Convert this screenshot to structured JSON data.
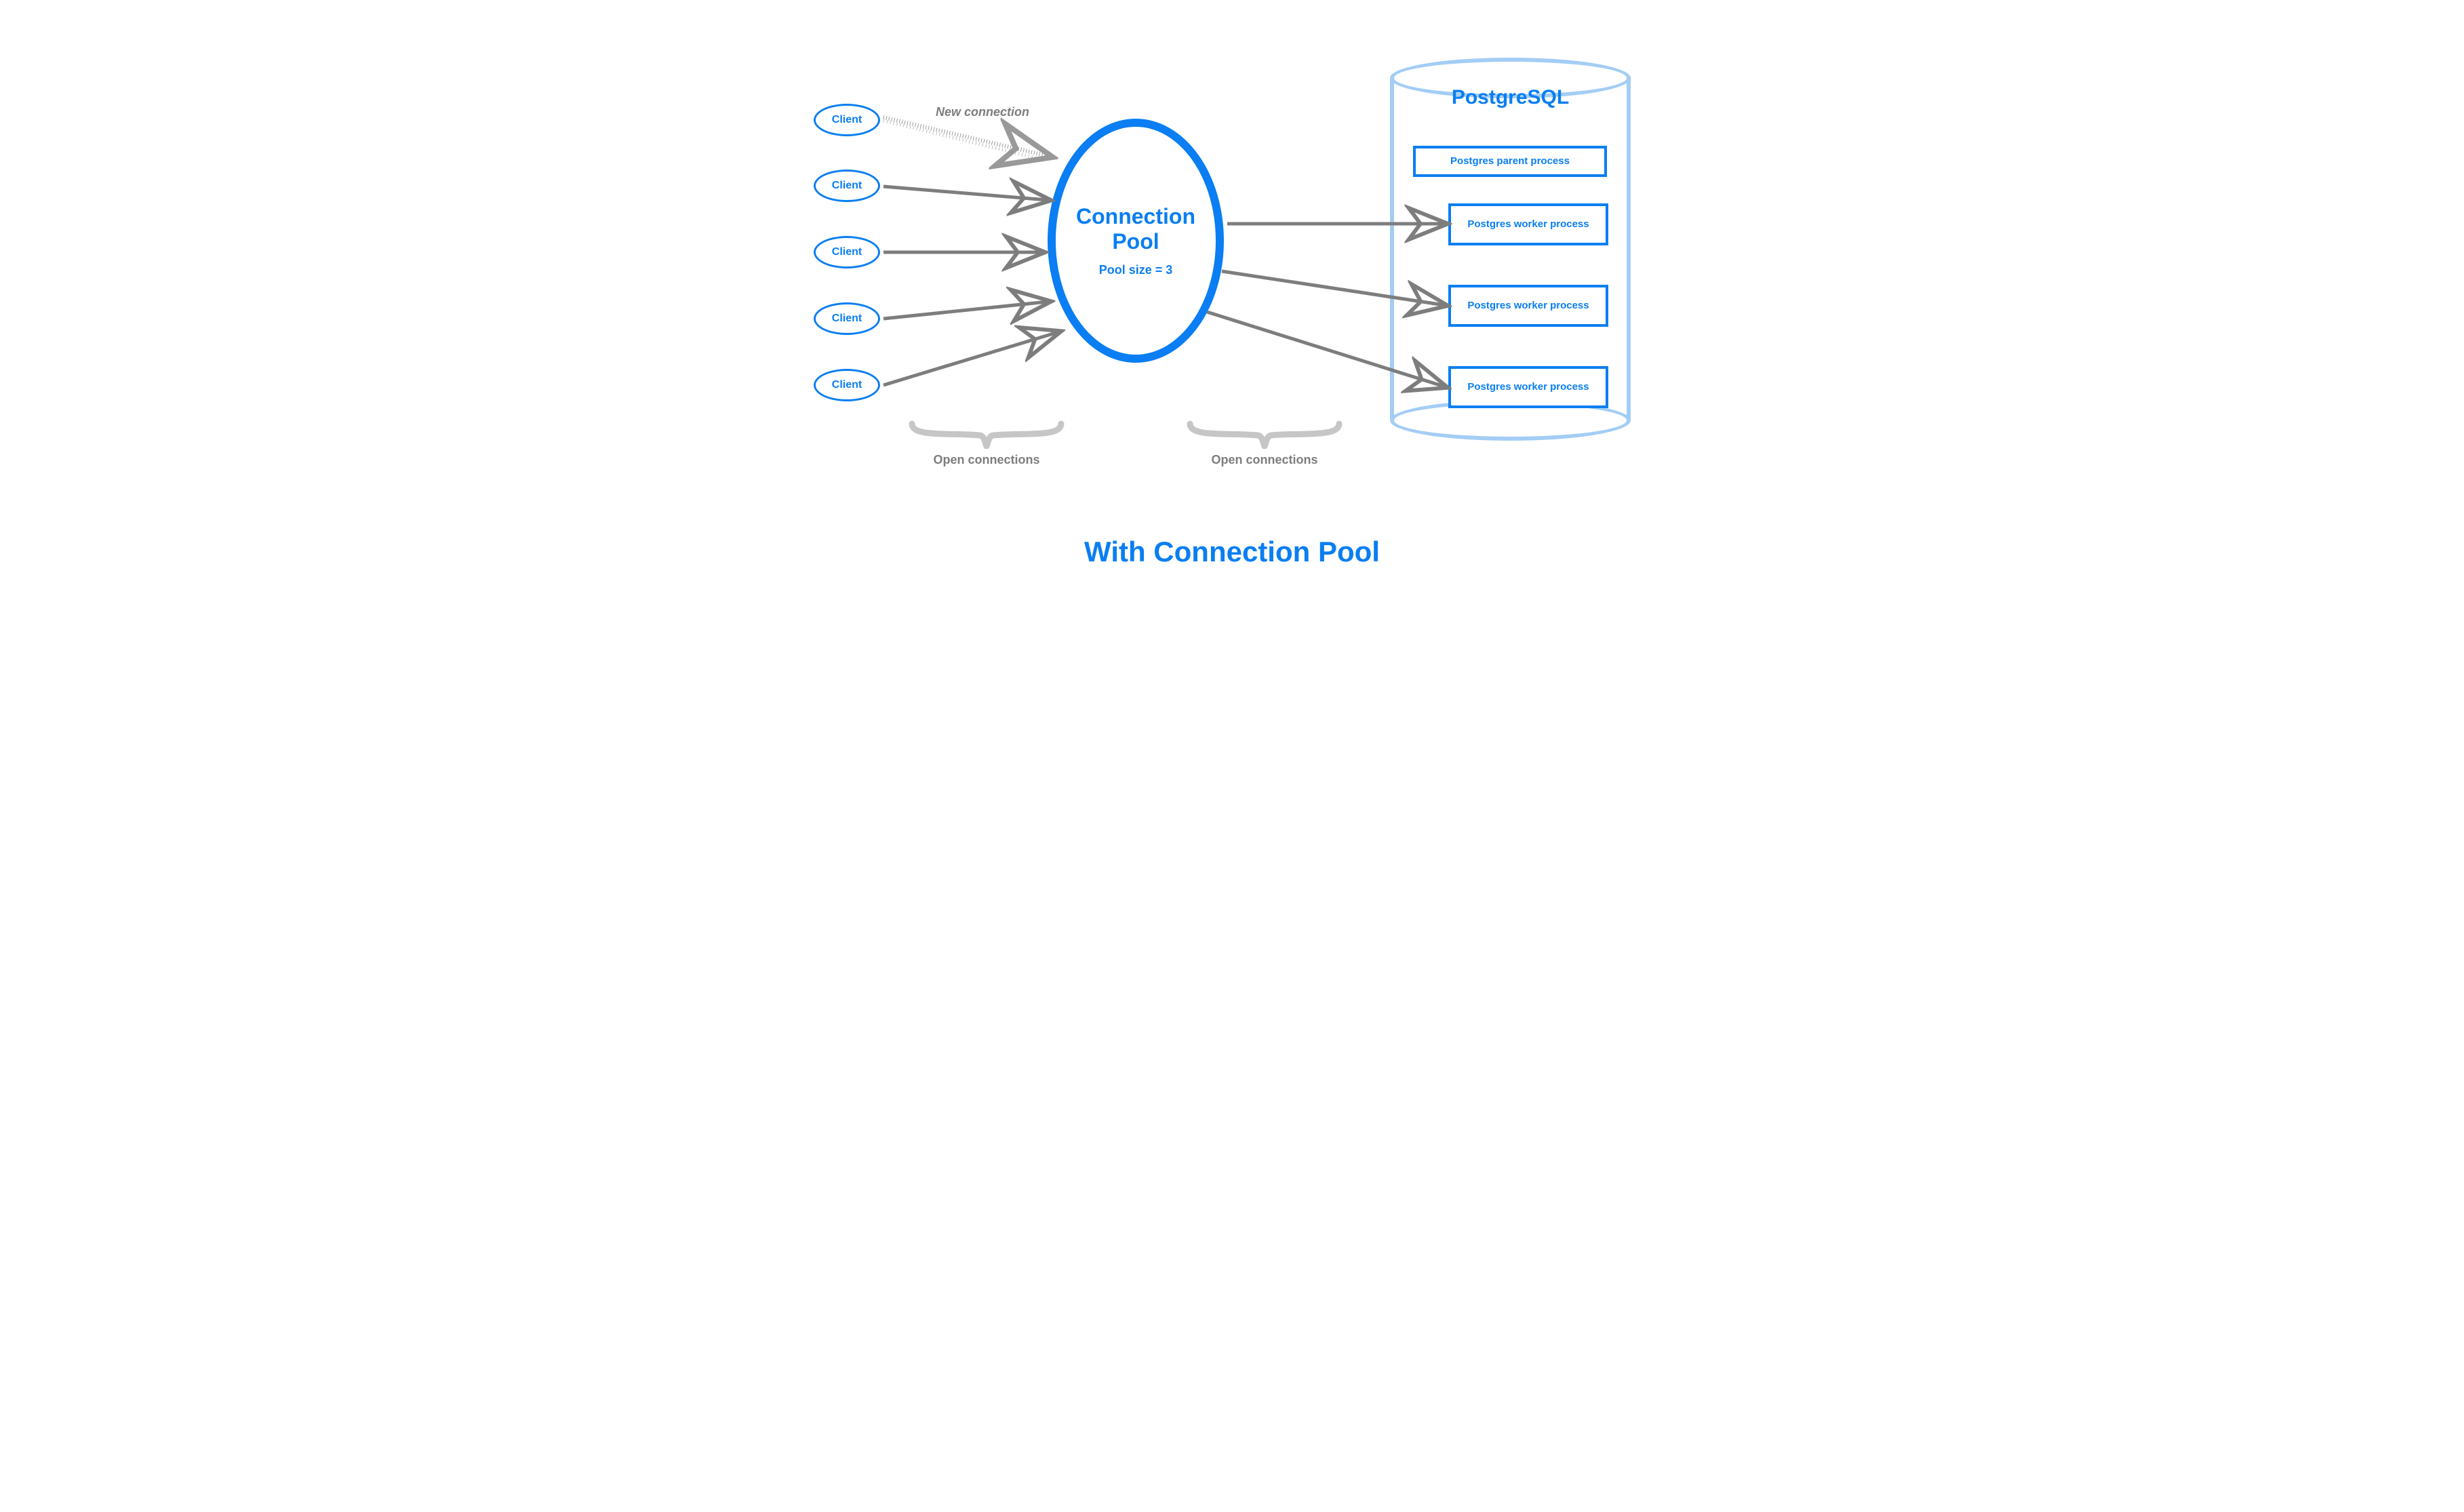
{
  "clients": [
    {
      "label": "Client"
    },
    {
      "label": "Client"
    },
    {
      "label": "Client"
    },
    {
      "label": "Client"
    },
    {
      "label": "Client"
    }
  ],
  "pool": {
    "title": "Connection Pool",
    "subtitle": "Pool size = 3"
  },
  "db": {
    "title": "PostgreSQL",
    "parent": "Postgres parent process",
    "workers": [
      "Postgres worker process",
      "Postgres worker process",
      "Postgres worker process"
    ]
  },
  "labels": {
    "new_connection": "New connection",
    "open_connections_left": "Open connections",
    "open_connections_right": "Open connections"
  },
  "caption": "With Connection Pool"
}
